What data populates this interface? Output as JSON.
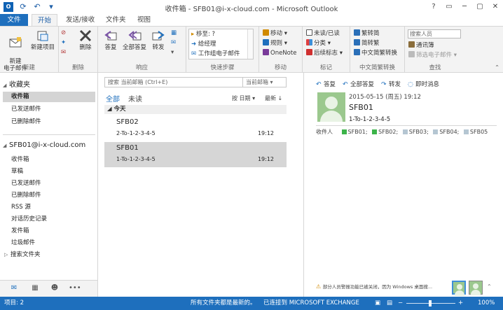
{
  "app": {
    "title": "收件箱 - SFB01@i-x-cloud.com - Microsoft Outlook",
    "icon_letter": "O"
  },
  "window_controls": [
    "?",
    "▭",
    "─",
    "▢",
    "✕"
  ],
  "tabs": [
    {
      "label": "文件"
    },
    {
      "label": "开始"
    },
    {
      "label": "发送/接收"
    },
    {
      "label": "文件夹"
    },
    {
      "label": "视图"
    }
  ],
  "ribbon": {
    "new": {
      "label": "新建",
      "new_email": "新建\n电子邮件",
      "new_items": "新建项目"
    },
    "delete": {
      "label": "删除",
      "delete_btn": "删除"
    },
    "respond": {
      "label": "响应",
      "reply": "答复",
      "reply_all": "全部答复",
      "forward": "转发"
    },
    "quick_steps": {
      "label": "快速步骤",
      "items": [
        "移至: ?",
        "给经理",
        "工作组电子邮件"
      ]
    },
    "move": {
      "label": "移动",
      "move": "移动",
      "rules": "规则",
      "onenote": "OneNote"
    },
    "tags": {
      "label": "标记",
      "unread_read": "未读/已读",
      "categorize": "分类",
      "follow_up": "后续标志"
    },
    "chinese_conv": {
      "label": "中文简繁转换",
      "to_traditional": "繁转简",
      "to_simplified": "简转繁",
      "convert": "中文简繁转换"
    },
    "find": {
      "label": "查找",
      "search_people": "搜索人员",
      "address_book": "通讯簿",
      "filter_email": "筛选电子邮件"
    }
  },
  "nav": {
    "favorites_header": "收藏夹",
    "favorites": [
      "收件箱",
      "已发送邮件",
      "已删除邮件"
    ],
    "account_header": "SFB01@i-x-cloud.com",
    "folders": [
      "收件箱",
      "草稿",
      "已发送邮件",
      "已删除邮件",
      "RSS 源",
      "对话历史记录",
      "发件箱",
      "垃圾邮件",
      "搜索文件夹"
    ]
  },
  "list": {
    "search_placeholder": "搜索 当前邮箱 (Ctrl+E)",
    "scope": "当前邮箱",
    "filter_all": "全部",
    "filter_unread": "未读",
    "sort_by": "按 日期",
    "sort_order": "最新",
    "group_today": "今天",
    "messages": [
      {
        "from": "SFB02",
        "subject": "2-To-1-2-3-4-5",
        "time": "19:12"
      },
      {
        "from": "SFB01",
        "subject": "1-To-1-2-3-4-5",
        "time": "19:12"
      }
    ]
  },
  "reading": {
    "actions": [
      "答复",
      "全部答复",
      "转发",
      "即时消息"
    ],
    "date": "2015-05-15 (周五) 19:12",
    "from": "SFB01",
    "subject": "1-To-1-2-3-4-5",
    "to_label": "收件人",
    "recipients": [
      {
        "name": "SFB01;",
        "color": "#3cb44a"
      },
      {
        "name": "SFB02;",
        "color": "#3cb44a"
      },
      {
        "name": "SFB03;",
        "color": "#b5c6d2"
      },
      {
        "name": "SFB04;",
        "color": "#b5c6d2"
      },
      {
        "name": "SFB05",
        "color": "#b5c6d2"
      }
    ],
    "notice": "部分人员警报功能已被关闭，因为 Windows 桌面搜..."
  },
  "status": {
    "items": "项目: 2",
    "uptodate": "所有文件夹都是最新的。",
    "connected": "已连接到 MICROSOFT EXCHANGE",
    "zoom": "100%"
  },
  "colors": {
    "accent": "#1e6fbd",
    "ribbon_bg": "#f3f3f3",
    "selected_bg": "#d6d6d6"
  }
}
